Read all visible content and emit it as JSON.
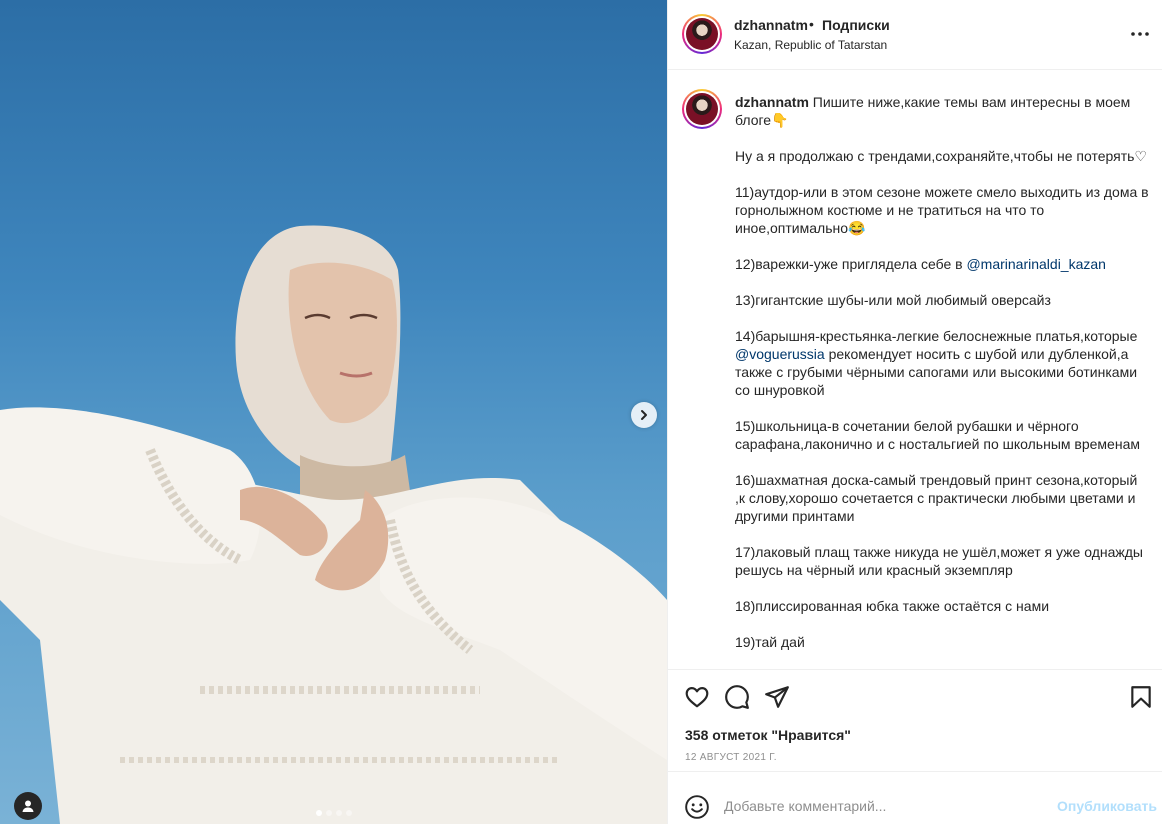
{
  "header": {
    "username": "dzhannatm",
    "separator": "•",
    "follow_label": "Подписки",
    "location": "Kazan, Republic of Tatarstan",
    "more_icon": "more-horizontal-icon"
  },
  "caption": {
    "username": "dzhannatm",
    "line1": " Пишите ниже,какие темы вам интересны в моем блоге👇",
    "line2": "Ну а я продолжаю с трендами,сохраняйте,чтобы не потерять♡",
    "line3": "11)аутдор-или в этом сезоне можете смело выходить из дома в горнолыжном костюме и не тратиться на что то иное,оптимально😂",
    "line4_pre": "12)варежки-уже приглядела себе в ",
    "mention1": "@marinarinaldi_kazan",
    "line5": "13)гигантские шубы-или мой любимый оверсайз",
    "line6_pre": "14)барышня-крестьянка-легкие белоснежные платья,которые ",
    "mention2": "@voguerussia",
    "line6_post": " рекомендует носить с шубой или дубленкой,а также с грубыми чёрными сапогами или высокими ботинками со шнуровкой",
    "line7": "15)школьница-в сочетании белой рубашки и чёрного сарафана,лаконично и с ностальгией по школьным временам",
    "line8": "16)шахматная доска-самый трендовый принт сезона,который ,к слову,хорошо сочетается с практически любыми цветами и другими принтами",
    "line9": "17)лаковый плащ также никуда не ушёл,может я уже однажды решусь на чёрный или красный экземпляр",
    "line10": "18)плиссированная юбка также остаётся с нами",
    "line11": "19)тай дай"
  },
  "actions": {
    "like_icon": "heart-icon",
    "comment_icon": "comment-icon",
    "share_icon": "paper-plane-icon",
    "save_icon": "bookmark-icon",
    "likes_text": "358 отметок \"Нравится\"",
    "date": "12 АВГУСТ 2021 Г."
  },
  "comment_box": {
    "emoji_icon": "smiley-icon",
    "placeholder": "Добавьте комментарий...",
    "publish_label": "Опубликовать"
  },
  "media": {
    "next_icon": "chevron-right-icon",
    "tag_icon": "user-tag-icon",
    "slide_count": 4,
    "active_slide": 1
  },
  "colors": {
    "sky": "#3f86bd",
    "mention": "#00376b",
    "publish_disabled": "#b2dffc",
    "meta_gray": "#8e8e8e"
  }
}
